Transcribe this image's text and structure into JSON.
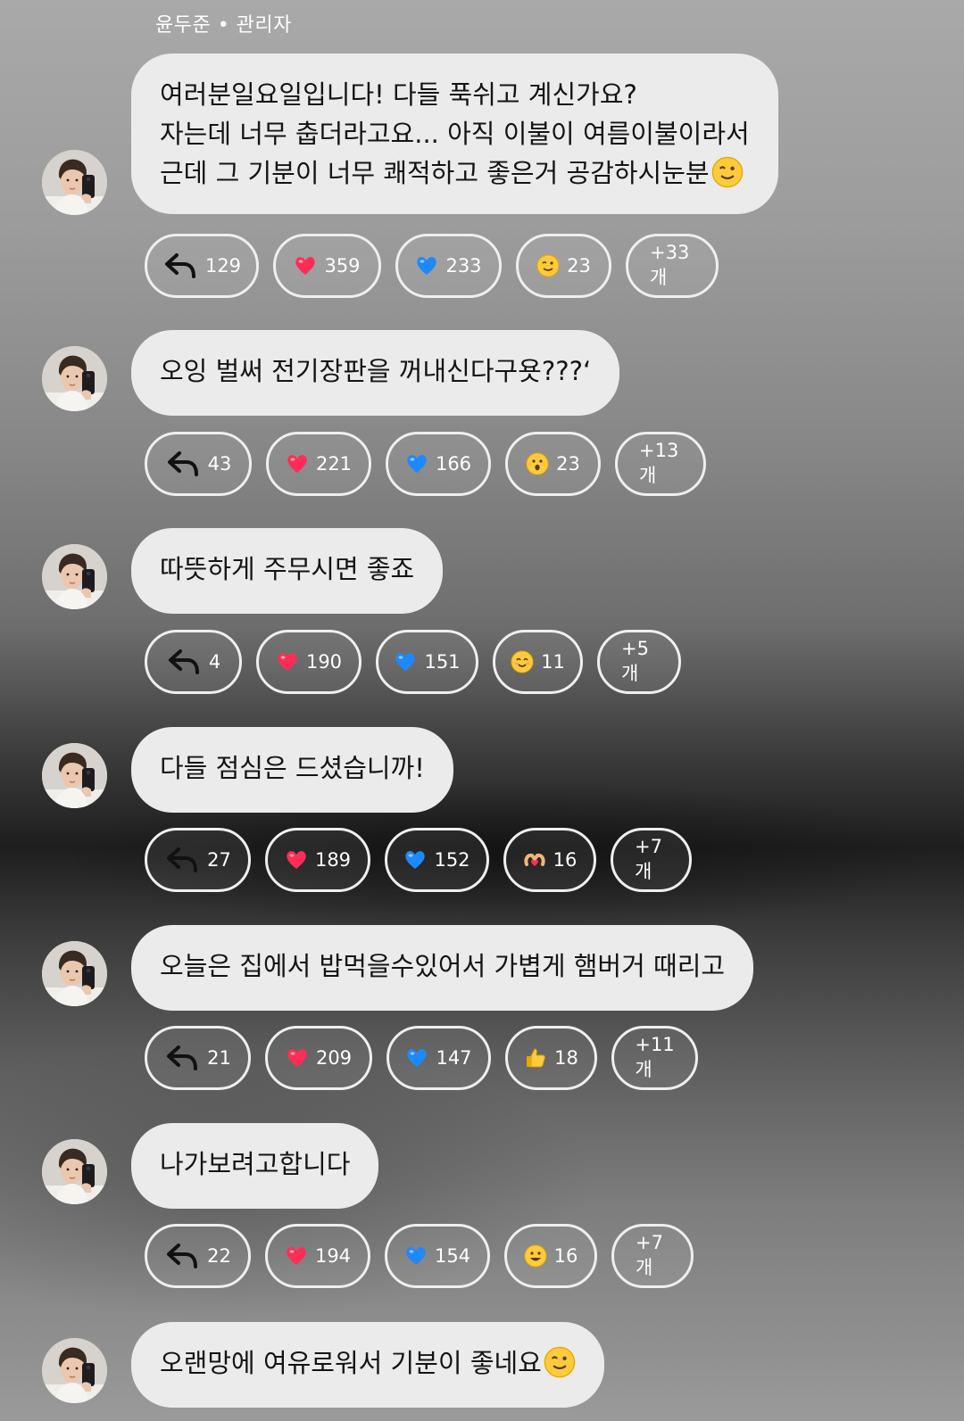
{
  "sender_label": "윤두준 • 관리자",
  "colors": {
    "bubble": "#ebebeb",
    "chip_border": "#efefef",
    "heart": "#ff2d55",
    "blue_heart": "#1e88ff"
  },
  "messages": [
    {
      "lines": [
        "여러분일요일입니다! 다들 푹쉬고 계신가요?",
        "자는데 너무 춥더라고요... 아직 이불이 여름이불이라서",
        "근데 그 기분이 너무 쾌적하고 좋은거 공감하시눈분"
      ],
      "trailing_emoji": "winking-face",
      "reactions": {
        "replies": "129",
        "red_heart": "359",
        "blue_heart": "233",
        "third_emoji": "winking-face",
        "third_count": "23",
        "more": "+33개"
      }
    },
    {
      "lines": [
        "오잉 벌써 전기장판을 꺼내신다구욧???‘"
      ],
      "trailing_emoji": "",
      "reactions": {
        "replies": "43",
        "red_heart": "221",
        "blue_heart": "166",
        "third_emoji": "surprised-face",
        "third_count": "23",
        "more": "+13개"
      }
    },
    {
      "lines": [
        "따뜻하게 주무시면 좋죠"
      ],
      "trailing_emoji": "",
      "reactions": {
        "replies": "4",
        "red_heart": "190",
        "blue_heart": "151",
        "third_emoji": "smiling-face",
        "third_count": "11",
        "more": "+5개"
      }
    },
    {
      "lines": [
        "다들 점심은 드셨습니까!"
      ],
      "trailing_emoji": "",
      "reactions": {
        "replies": "27",
        "red_heart": "189",
        "blue_heart": "152",
        "third_emoji": "heart-hands",
        "third_count": "16",
        "more": "+7개"
      }
    },
    {
      "lines": [
        "오늘은 집에서 밥먹을수있어서 가볍게 햄버거 때리고"
      ],
      "trailing_emoji": "",
      "reactions": {
        "replies": "21",
        "red_heart": "209",
        "blue_heart": "147",
        "third_emoji": "thumbs-up",
        "third_count": "18",
        "more": "+11개"
      }
    },
    {
      "lines": [
        "나가보려고합니다"
      ],
      "trailing_emoji": "",
      "reactions": {
        "replies": "22",
        "red_heart": "194",
        "blue_heart": "154",
        "third_emoji": "grinning-face",
        "third_count": "16",
        "more": "+7개"
      }
    },
    {
      "lines": [
        "오랜망에 여유로워서 기분이 좋네요"
      ],
      "trailing_emoji": "winking-face",
      "reactions": null
    }
  ]
}
